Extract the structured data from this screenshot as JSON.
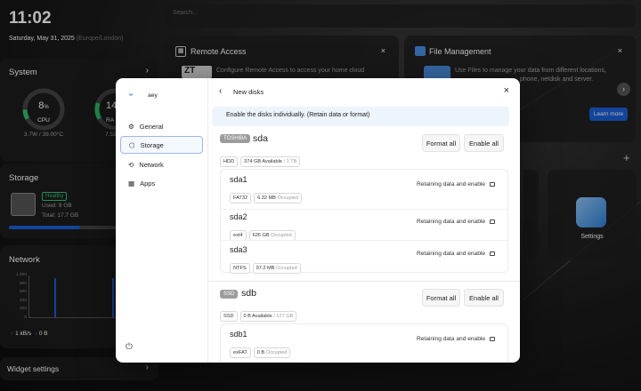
{
  "time": {
    "clock": "11:02",
    "date": "Saturday, May 31, 2025",
    "timezone": "(Europe/London)"
  },
  "search": {
    "placeholder": "Search..."
  },
  "system": {
    "title": "System",
    "cpu_value": "8",
    "cpu_unit": "%",
    "cpu_label": "CPU",
    "cpu_detail": "3.7W / 39.00°C",
    "ram_value": "14",
    "ram_label": "RA",
    "ram_detail": "7.52"
  },
  "storage_widget": {
    "title": "Storage",
    "badge": "Healthy",
    "used": "Used: 9 GB",
    "total": "Total: 17.7 GB",
    "usage_fraction": 0.5
  },
  "network": {
    "title": "Network",
    "yticks": [
      "1,000",
      "800",
      "600",
      "400",
      "200",
      "0"
    ],
    "up": "1 kB/s",
    "down": "0 B"
  },
  "widget_settings": {
    "label": "Widget settings"
  },
  "remote_access": {
    "title": "Remote Access",
    "text": "Configure Remote Access to access your home cloud",
    "logo": "ZT"
  },
  "file_mgmt": {
    "title": "File Management",
    "text1": "Use Files to manage your data from different locations,",
    "text2": "phone, netdisk and server.",
    "learn_more": "Learn more"
  },
  "settings_app": {
    "label": "Settings"
  },
  "modal": {
    "user": "aey",
    "nav": [
      {
        "label": "General"
      },
      {
        "label": "Storage"
      },
      {
        "label": "Network"
      },
      {
        "label": "Apps"
      }
    ],
    "title": "New disks",
    "banner": "Enable the disks individually. (Retain data or format)",
    "format_all": "Format all",
    "enable_all": "Enable all",
    "disks": [
      {
        "brand": "TOSHIBA",
        "name": "sda",
        "type": "HDD",
        "available": "374 GB Available",
        "capacity": "/ 1 TB",
        "partitions": [
          {
            "name": "sda1",
            "fs": "FAT32",
            "size": "6.32 MB",
            "occ": "Occupied",
            "action": "Retaining data and enable"
          },
          {
            "name": "sda2",
            "fs": "ext4",
            "size": "626 GB",
            "occ": "Occupied",
            "action": "Retaining data and enable"
          },
          {
            "name": "sda3",
            "fs": "NTFS",
            "size": "97.2 MB",
            "occ": "Occupied",
            "action": "Retaining data and enable"
          }
        ]
      },
      {
        "brand": "SSD",
        "name": "sdb",
        "type": "SSD",
        "available": "0 B Available",
        "capacity": "/ 127 GB",
        "partitions": [
          {
            "name": "sdb1",
            "fs": "exFAT",
            "size": "0 B",
            "occ": "Occupied",
            "action": "Retaining data and enable"
          }
        ]
      }
    ]
  },
  "colors": {
    "accent": "#1a5fd6",
    "healthy": "#31c27c",
    "gauge": "#2fbf6b"
  }
}
